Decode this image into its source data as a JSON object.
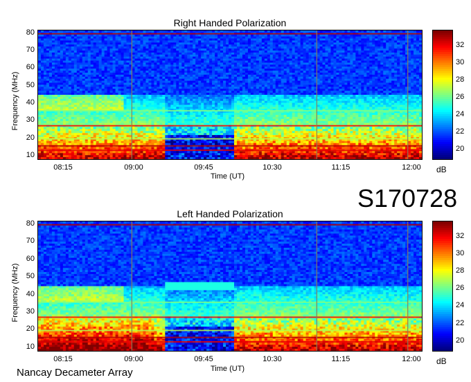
{
  "event_id": "S170728",
  "footer": "Nancay Decameter Array",
  "chart_data": [
    {
      "type": "heatmap",
      "title": "Right Handed Polarization",
      "xlabel": "Time (UT)",
      "ylabel": "Frequency (MHz)",
      "x_ticks": [
        "08:15",
        "09:00",
        "09:45",
        "10:30",
        "11:15",
        "12:00"
      ],
      "y_ticks": [
        "10",
        "20",
        "30",
        "40",
        "50",
        "60",
        "70",
        "80"
      ],
      "ylim": [
        10,
        80
      ],
      "colorbar": {
        "unit": "dB",
        "ticks": [
          "20",
          "22",
          "24",
          "26",
          "28",
          "30",
          "32"
        ],
        "range": [
          18.8,
          33.8
        ]
      }
    },
    {
      "type": "heatmap",
      "title": "Left Handed Polarization",
      "xlabel": "Time (UT)",
      "ylabel": "Frequency (MHz)",
      "x_ticks": [
        "08:15",
        "09:00",
        "09:45",
        "10:30",
        "11:15",
        "12:00"
      ],
      "y_ticks": [
        "10",
        "20",
        "30",
        "40",
        "50",
        "60",
        "70",
        "80"
      ],
      "ylim": [
        10,
        80
      ],
      "colorbar": {
        "unit": "dB",
        "ticks": [
          "20",
          "22",
          "24",
          "26",
          "28",
          "30",
          "32"
        ],
        "range": [
          18.8,
          33.8
        ]
      }
    }
  ]
}
